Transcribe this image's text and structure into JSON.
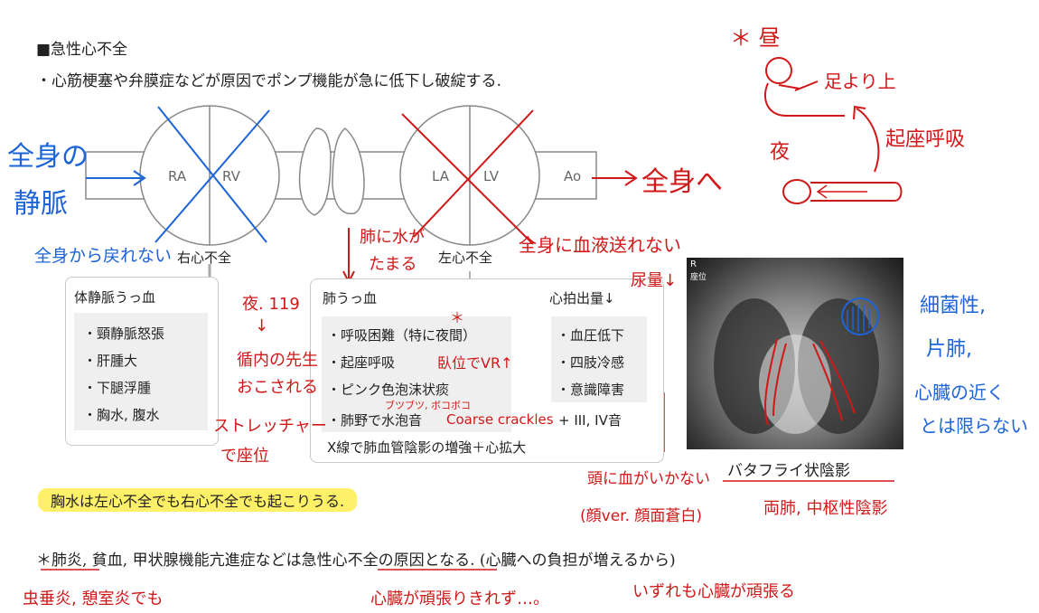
{
  "heading": "■急性心不全",
  "intro": "・心筋梗塞や弁膜症などが原因でポンプ機能が急に低下し破綻する.",
  "diagram": {
    "ra": "RA",
    "rv": "RV",
    "la": "LA",
    "lv": "LV",
    "ao": "Ao",
    "right_hf": "右心不全",
    "left_hf": "左心不全"
  },
  "systemic_box": {
    "title": "体静脈うっ血",
    "items": [
      "・頸静脈怒張",
      "・肝腫大",
      "・下腿浮腫",
      "・胸水, 腹水"
    ]
  },
  "pulmonary_box": {
    "title": "肺うっ血",
    "items": [
      "・呼吸困難（特に夜間）",
      "・起座呼吸",
      "・ピンク色泡沫状痰",
      "・肺野で水泡音"
    ],
    "plus": "+ III, IV音",
    "xray": "X線で肺血管陰影の増強＋心拡大"
  },
  "output_box": {
    "title": "心拍出量↓",
    "items": [
      "・血圧低下",
      "・四肢冷感",
      "・意識障害"
    ]
  },
  "xray_caption": "バタフライ状陰影",
  "xray_marker": "R",
  "xray_position": "座位",
  "highlight_note": "胸水は左心不全でも右心不全でも起こりうる.",
  "bottom_note": "＊肺炎, 貧血, 甲状腺機能亢進症などは急性心不全の原因となる. (心臓への負担が増えるから)",
  "annotations": {
    "whole_body_veins_1": "全身の",
    "whole_body_veins_2": "静脈",
    "to_whole_body": "全身へ",
    "not_return": "全身から戻れない",
    "lung_water_1": "肺に水が",
    "lung_water_2": "たまる",
    "no_blood_to_body": "全身に血液送れない",
    "urine_down": "尿量↓",
    "night_119": "夜. 119",
    "arrow_down": "↓",
    "out_of_hospital_1": "循内の先生",
    "out_of_hospital_2": "おこされる",
    "stretcher_1": "ストレッチャー",
    "stretcher_2": "で座位",
    "asterisk": "＊",
    "supine_vr_up": "臥位でVR↑",
    "bubbling": "ブツブツ, ボコボコ",
    "coarse_crackles": "Coarse crackles",
    "head_no_blood": "頭に血がいかない",
    "pale_face": "(顔ver. 顔面蒼白)",
    "bilateral": "両肺, 中枢性陰影",
    "bacterial_1": "細菌性,",
    "bacterial_2": "片肺,",
    "bacterial_3": "心臓の近く",
    "bacterial_4": "とは限らない",
    "day": "＊ 昼",
    "above_legs": "足より上",
    "orthopnea": "起座呼吸",
    "night": "夜",
    "pneumonia_note": "虫垂炎, 憩室炎でも",
    "heart_overwork": "心臓が頑張りきれず…。",
    "both_heart_work": "いずれも心臓が頑張る"
  }
}
